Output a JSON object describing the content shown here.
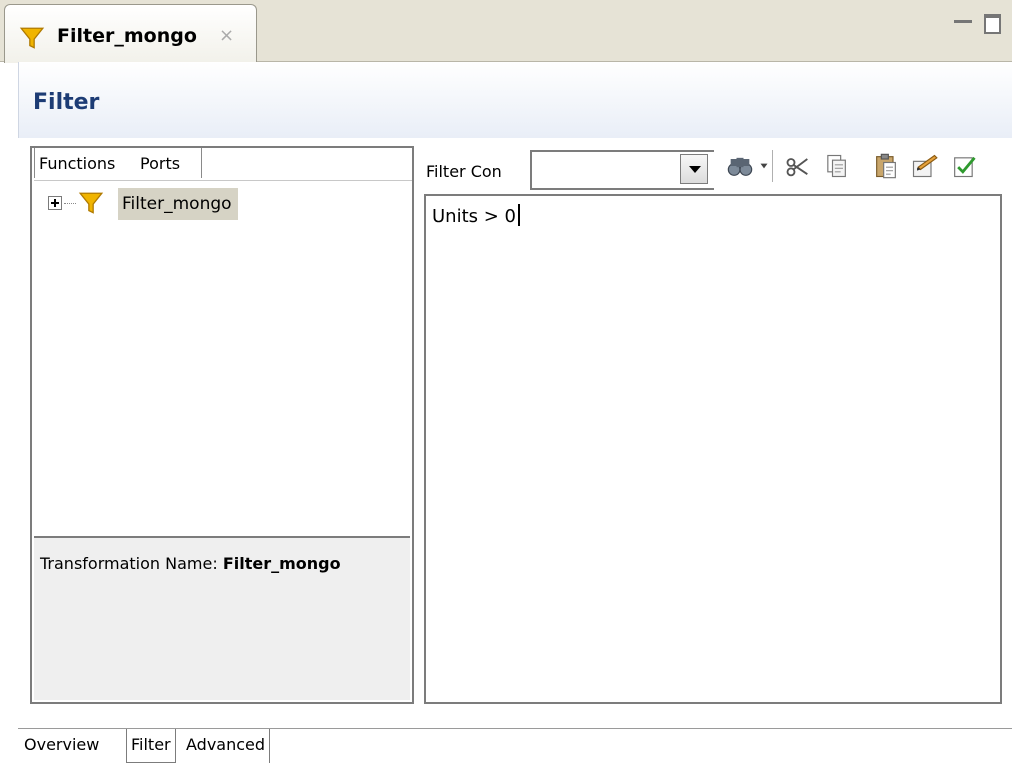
{
  "editor_tab": {
    "title": "Filter_mongo",
    "close_glyph": "×",
    "icon": "filter-funnel-icon"
  },
  "header": {
    "title": "Filter"
  },
  "left_panel": {
    "tabs": [
      {
        "label": "Functions"
      },
      {
        "label": "Ports"
      }
    ],
    "selected_tab": "Ports",
    "tree": {
      "node_label": "Filter_mongo",
      "expanded": false
    },
    "transformation": {
      "label": "Transformation Name:",
      "value": "Filter_mongo"
    }
  },
  "right_panel": {
    "filter_label": "Filter Con",
    "filter_select_value": "",
    "toolbar_icons": [
      "binoculars-icon",
      "cut-icon",
      "copy-icon",
      "paste-icon",
      "edit-icon",
      "validate-icon"
    ],
    "expression": "Units > 0"
  },
  "bottom_tabs": [
    {
      "label": "Overview"
    },
    {
      "label": "Filter"
    },
    {
      "label": "Advanced"
    }
  ],
  "selected_bottom_tab": "Filter",
  "colors": {
    "title": "#1d3c75",
    "funnel": "#f0b400",
    "selection": "#d6d3c5"
  }
}
